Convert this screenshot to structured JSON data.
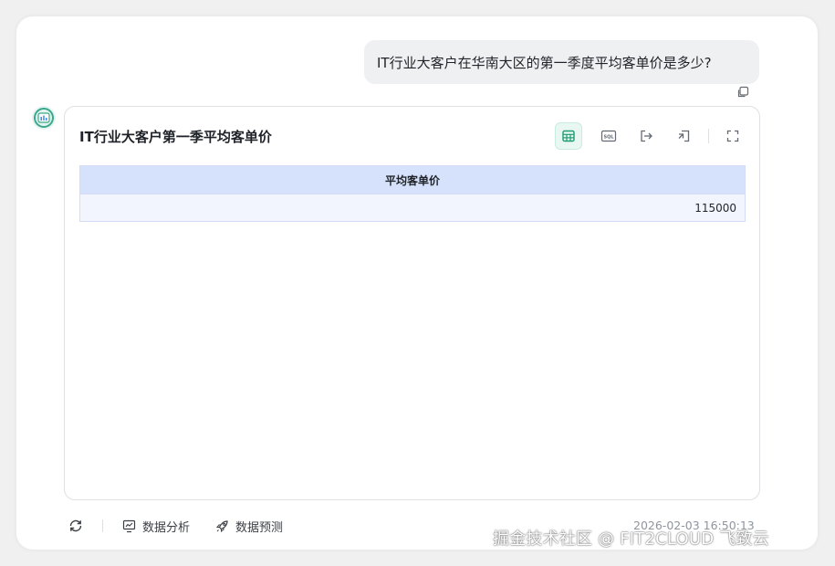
{
  "user_message": "IT行业大客户在华南大区的第一季度平均客单价是多少?",
  "card": {
    "title": "IT行业大客户第一季平均客单价",
    "toolbar": [
      "table-icon",
      "sql-icon",
      "export-icon",
      "add-to-dashboard-icon",
      "fullscreen-icon"
    ],
    "sql_label": "SQL",
    "table": {
      "columns": [
        "平均客单价"
      ],
      "rows": [
        [
          "115000"
        ]
      ]
    }
  },
  "footer": {
    "analysis_label": "数据分析",
    "predict_label": "数据预测",
    "timestamp": "2026-02-03 16:50:13"
  },
  "watermark": "掘金技术社区 @ FIT2CLOUD 飞致云",
  "colors": {
    "accent": "#1f9c74",
    "header_bg": "#d6e2fb",
    "row_bg": "#f2f5fd"
  }
}
